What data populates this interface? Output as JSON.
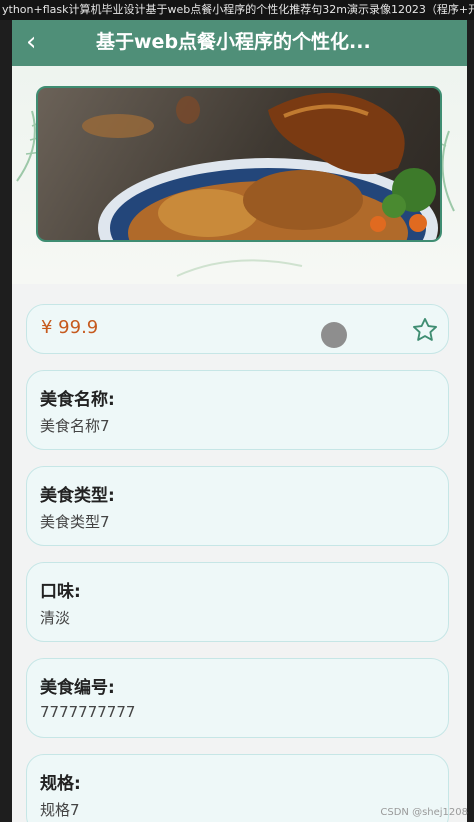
{
  "video_title": "ython+flask计算机毕业设计基于web点餐小程序的个性化推荐句32m演示录像12023（程序+开题+论文）.m",
  "header": {
    "back_label": "‹",
    "title": "基于web点餐小程序的个性化..."
  },
  "product": {
    "price": "¥ 99.9",
    "fields": [
      {
        "label": "美食名称:",
        "value": "美食名称7"
      },
      {
        "label": "美食类型:",
        "value": "美食类型7"
      },
      {
        "label": "口味:",
        "value": "清淡"
      },
      {
        "label": "美食编号:",
        "value": "7777777777"
      },
      {
        "label": "规格:",
        "value": "规格7"
      }
    ]
  },
  "icons": {
    "back": "chevron-left-icon",
    "favorite": "star-outline-icon"
  },
  "colors": {
    "header": "#4f8f78",
    "price": "#c65a1e",
    "card_bg": "#eef8f8",
    "card_border": "#c6e6e6"
  },
  "watermark": "CSDN @shej1208"
}
